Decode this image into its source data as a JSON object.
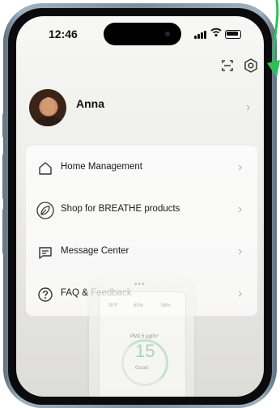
{
  "status_bar": {
    "time": "12:46"
  },
  "profile": {
    "name": "Anna"
  },
  "menu": [
    {
      "label": "Home Management",
      "icon": "home-icon"
    },
    {
      "label": "Shop for BREATHE products",
      "icon": "leaf-icon"
    },
    {
      "label": "Message Center",
      "icon": "message-icon"
    },
    {
      "label": "FAQ & Feedback",
      "icon": "question-icon"
    }
  ],
  "device_preview": {
    "temp": "78°F",
    "humidity_left": "60%",
    "humidity_right": "58%",
    "pm_label": "PM2.5 μg/m³",
    "pm_value": "15",
    "status": "Good"
  },
  "colors": {
    "accent_arrow": "#2fbf5a",
    "good_status": "#9ccf9f"
  }
}
